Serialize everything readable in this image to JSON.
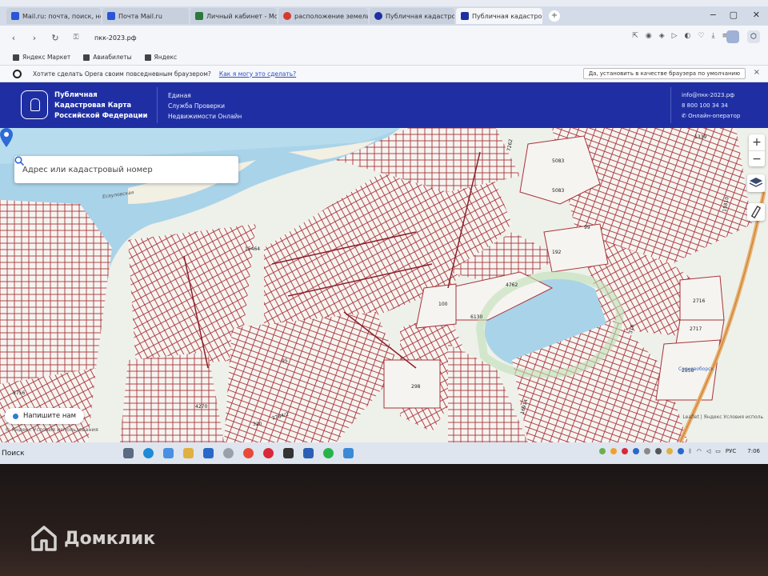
{
  "browser": {
    "tabs": [
      {
        "label": "Mail.ru: почта, поиск, но",
        "color": "#2a55d6"
      },
      {
        "label": "Почта Mail.ru",
        "color": "#2a55d6"
      },
      {
        "label": "Личный кабинет - Моя с",
        "color": "#2b7a3b"
      },
      {
        "label": "расположение земельн",
        "color": "#d43a2f"
      },
      {
        "label": "Публичная кадастровая",
        "color": "#1f2fa3"
      },
      {
        "label": "Публичная кадастровая",
        "color": "#1f2fa3",
        "active": true
      }
    ],
    "url": "пкк-2023.рф",
    "bookmarks": [
      "Яндекс Маркет",
      "Авиабилеты",
      "Яндекс"
    ],
    "opera": {
      "prompt": "Хотите сделать Opera своим повседневным браузером?",
      "link": "Как я могу это сделать?",
      "button": "Да, установить в качестве браузера по умолчанию",
      "close": "×"
    }
  },
  "site": {
    "brand_lines": [
      "Публичная",
      "Кадастровая Карта",
      "Российской Федерации"
    ],
    "service_lines": [
      "Единая",
      "Служба Проверки",
      "Недвижимости Онлайн"
    ],
    "email": "info@пкк-2023.рф",
    "phone": "8 800 100 34 34",
    "operator": "Онлайн-оператор"
  },
  "map": {
    "search_placeholder": "Адрес или кадастровый номер",
    "zoom_in": "+",
    "zoom_out": "−",
    "chat_label": "Напишите нам",
    "yandex_attrib": "© Яндекс  Условия использования",
    "leaflet_attrib": "Leaflet | Яндекс  Условия исполь",
    "parcel_labels": [
      "5083",
      "5083",
      "7262",
      "1339",
      "15810",
      "99",
      "192",
      "4762",
      "100",
      "6130",
      "2716",
      "2717",
      "2858",
      "298",
      "95",
      "4270",
      "320",
      "2784/2",
      "5756",
      "15464",
      "16914",
      "316"
    ],
    "place_labels": [
      "Есауловская",
      "Сосновоборск"
    ]
  },
  "taskbar": {
    "search_label": "Поиск",
    "lang": "РУС",
    "time": "7:06"
  },
  "watermark": "Домклик"
}
